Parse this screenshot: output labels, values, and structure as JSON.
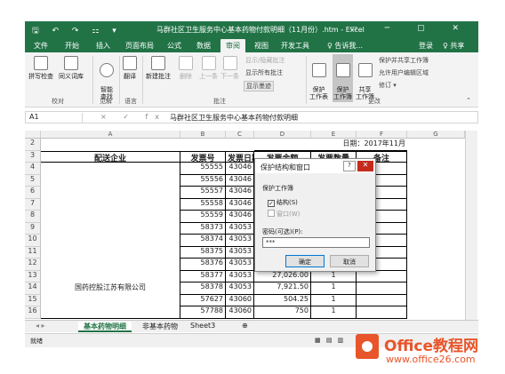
{
  "window": {
    "title": "马群社区卫生服务中心基本药物付款明细（11月份）.htm - Excel",
    "qa_icons": "🖫 ↶ ↷ ⚏ ▾",
    "win_icons": "▭ ─ ▢ ✕"
  },
  "tabs": [
    {
      "label": "文件"
    },
    {
      "label": "开始"
    },
    {
      "label": "插入"
    },
    {
      "label": "页面布局"
    },
    {
      "label": "公式"
    },
    {
      "label": "数据"
    },
    {
      "label": "审阅"
    },
    {
      "label": "视图"
    },
    {
      "label": "开发工具"
    },
    {
      "label": "♀ 告诉我..."
    }
  ],
  "account": {
    "login": "登录",
    "share": "♀ 共享"
  },
  "ribbon": {
    "spell": "拼写检查",
    "thesaurus": "同义词库",
    "smart_lookup": "智能\n查找",
    "translate": "翻译",
    "new_comment": "新建批注",
    "delete": "删除",
    "prev": "上一条",
    "next": "下一条",
    "show_hide": "显示/隐藏批注",
    "show_all": "显示所有批注",
    "show_ink": "显示墨迹",
    "protect_sheet": "保护\n工作表",
    "protect_book": "保护\n工作簿",
    "share_book": "共享\n工作簿",
    "protect_share": "保护并共享工作簿",
    "allow_edit": "允许用户编辑区域",
    "track": "修订 ▾",
    "group_proofing": "校对",
    "group_insights": "见解",
    "group_language": "语言",
    "group_comments": "批注",
    "group_changes": "更改"
  },
  "formula_bar": {
    "name_box": "A1",
    "fx": "×  ✓  fx",
    "content": "马群社区卫生服务中心基本药物付款明细"
  },
  "grid": {
    "columns": [
      "A",
      "B",
      "C",
      "D",
      "E",
      "F",
      "G"
    ],
    "rows": [
      "2",
      "3",
      "4",
      "5",
      "6",
      "7",
      "8",
      "9",
      "10",
      "11",
      "12",
      "13",
      "14",
      "15",
      "16"
    ],
    "date_label": "日期：2017年11月",
    "headers": [
      "配送企业",
      "发票号",
      "发票日期",
      "发票金额",
      "发票数量",
      "备注"
    ],
    "company": "国药控股江苏有限公司",
    "invoice_numbers": [
      "55555",
      "55556",
      "55557",
      "55558",
      "55559",
      "58373",
      "58374",
      "58375",
      "58376",
      "58377",
      "58378",
      "57627",
      "57788"
    ],
    "invoice_dates": [
      "43046",
      "43046",
      "43046",
      "43046",
      "43046",
      "43053",
      "43053",
      "43053",
      "43053",
      "43053",
      "43053",
      "43060",
      "43060"
    ],
    "amounts": [
      "",
      "",
      "",
      "",
      "",
      "",
      "",
      "",
      "",
      "27,026.00",
      "7,921.50",
      "504.25",
      "750"
    ],
    "quantities": [
      "",
      "",
      "",
      "",
      "",
      "",
      "",
      "",
      "",
      "1",
      "1",
      "1",
      "1"
    ]
  },
  "sheets": {
    "tabs": [
      "基本药物明细",
      "非基本药物",
      "Sheet3"
    ],
    "add": "⊕"
  },
  "status": {
    "ready": "就绪",
    "view_icons": "▦  ▤  ▥"
  },
  "dialog": {
    "title": "保护结构和窗口",
    "help": "?",
    "close": "✕",
    "group": "保护工作簿",
    "structure": "结构(S)",
    "windows": "窗口(W)",
    "password_label": "密码(可选)(P):",
    "password_value": "***",
    "ok": "确定",
    "cancel": "取消"
  },
  "watermark": {
    "brand": "Office教程网",
    "url": "www.office26.com"
  }
}
